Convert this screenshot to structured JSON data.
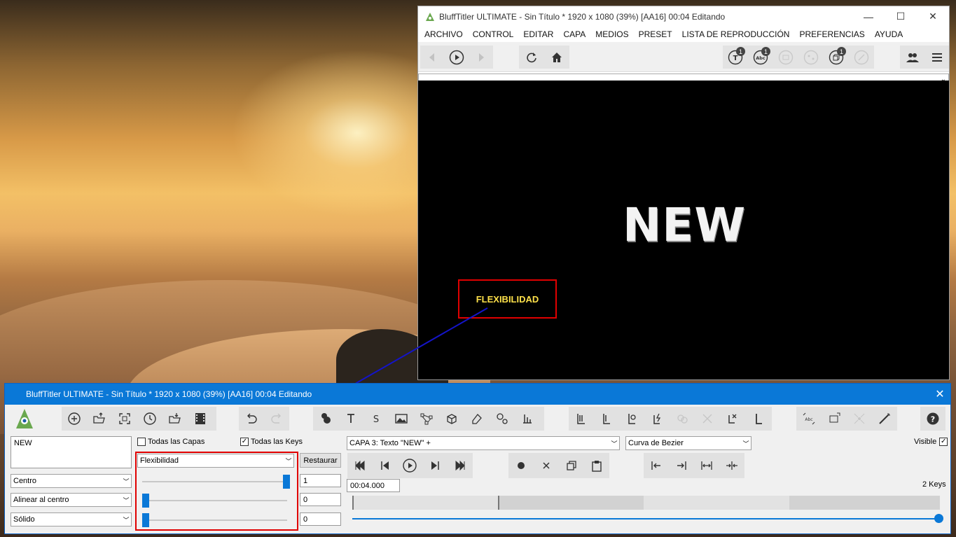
{
  "preview_window": {
    "title": "BluffTitler ULTIMATE  - Sin Título * 1920 x 1080 (39%) [AA16] 00:04 Editando",
    "window_controls": {
      "minimize": "—",
      "maximize": "☐",
      "close": "✕"
    },
    "menu": [
      "ARCHIVO",
      "CONTROL",
      "EDITAR",
      "CAPA",
      "MEDIOS",
      "PRESET",
      "LISTA DE REPRODUCCIÓN",
      "PREFERENCIAS",
      "AYUDA"
    ],
    "badges": {
      "text_layers": "1",
      "abc_layers": "1",
      "cube_layers": "1"
    },
    "canvas_text": "NEW",
    "annotation_label": "FLEXIBILIDAD"
  },
  "control_window": {
    "title": "BluffTitler ULTIMATE  - Sin Título * 1920 x 1080 (39%) [AA16] 00:04 Editando",
    "close": "✕",
    "text_input": "NEW",
    "todas_capas": "Todas las Capas",
    "todas_keys": "Todas las Keys",
    "align_select": "Centro",
    "justify_select": "Alinear al centro",
    "style_select": "Sólido",
    "property_select": "Flexibilidad",
    "restaurar": "Restaurar",
    "slider_values": [
      "1",
      "0",
      "0"
    ],
    "slider_levels": [
      1.0,
      0.0,
      0.0
    ],
    "layer_select": "CAPA 3: Texto \"NEW\" +",
    "curve_select": "Curva de Bezier",
    "visible_label": "Visible",
    "time_input": "00:04.000",
    "keys_count": "2 Keys",
    "timeline_progress": 1.0
  },
  "colors": {
    "accent": "#0a78d7",
    "highlight_red": "#e00000",
    "annotation_text": "#ffe14a",
    "arrow": "#1414c8"
  }
}
